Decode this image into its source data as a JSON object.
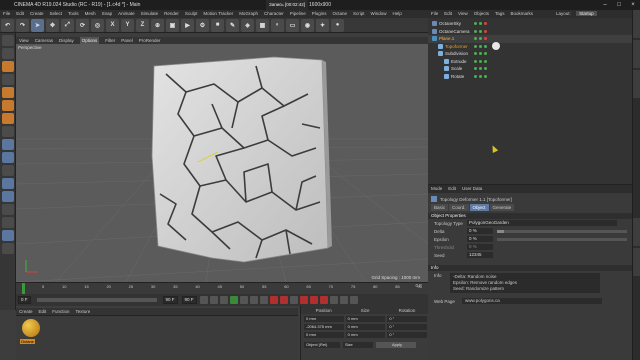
{
  "window": {
    "app_title": "CINEMA 4D R19.024 Studio (RC - R19) - [1.c4d *] - Main",
    "center_title": "1600x900",
    "overlay_title": "Запись [00:02:42]",
    "btn_min": "–",
    "btn_max": "□",
    "btn_close": "×"
  },
  "menubar": [
    "File",
    "Edit",
    "Create",
    "Select",
    "Tools",
    "Mesh",
    "Snap",
    "Animate",
    "Simulate",
    "Render",
    "Sculpt",
    "Motion Tracker",
    "MoGraph",
    "Character",
    "Pipeline",
    "Plugins",
    "Octane",
    "Script",
    "Window",
    "Help"
  ],
  "toolbar": {
    "x": "X",
    "y": "Y",
    "z": "Z"
  },
  "viewport": {
    "menu": [
      "View",
      "Cameras",
      "Display",
      "Options",
      "Filter",
      "Panel",
      "ProRender"
    ],
    "active_menu": "Options",
    "label": "Perspective",
    "grid_spacing": "Grid Spacing : 1000 mm"
  },
  "timeline": {
    "ticks": [
      "0",
      "5",
      "10",
      "15",
      "20",
      "25",
      "30",
      "35",
      "40",
      "45",
      "50",
      "55",
      "60",
      "65",
      "70",
      "75",
      "80",
      "85",
      "90"
    ],
    "current_frame": "0 F",
    "start_field": "0 F",
    "end_field": "90 F",
    "end_field2": "90 F"
  },
  "material": {
    "menu": [
      "Create",
      "Edit",
      "Function",
      "Texture"
    ],
    "mat_name": "Octane"
  },
  "coords": {
    "headers": [
      "Position",
      "Size",
      "Rotation"
    ],
    "px": "0 mm",
    "py": "-2064.375 mm",
    "pz": "0 mm",
    "sx": "0 mm",
    "sy": "0 mm",
    "sz": "0 mm",
    "rh": "0 °",
    "rp": "0 °",
    "rb": "0 °",
    "mode": "Object (Rel)",
    "size_mode": "Size",
    "apply": "Apply"
  },
  "objmgr": {
    "menu": [
      "File",
      "Edit",
      "View",
      "Objects",
      "Tags",
      "Bookmarks"
    ],
    "layout_label": "Layout:",
    "layout_value": "Startup",
    "objects": [
      {
        "name": "OctaneSky",
        "cls": "w",
        "indent": 0
      },
      {
        "name": "OctaneCamera",
        "cls": "w",
        "indent": 0
      },
      {
        "name": "Plane.1",
        "cls": "sel",
        "indent": 0
      },
      {
        "name": "Topoformer",
        "cls": "",
        "indent": 1
      },
      {
        "name": "Subdivision",
        "cls": "w",
        "indent": 1
      },
      {
        "name": "Extrude",
        "cls": "w",
        "indent": 2
      },
      {
        "name": "Scale",
        "cls": "w",
        "indent": 2
      },
      {
        "name": "Rotate",
        "cls": "w",
        "indent": 2
      }
    ]
  },
  "attr": {
    "menu": [
      "Mode",
      "Edit",
      "User Data"
    ],
    "object_title": "Topology Deformer 1.1 [Topoformer]",
    "tabs": [
      "Basic",
      "Coord.",
      "Object",
      "Generate"
    ],
    "active_tab": "Object",
    "section_object": "Object Properties",
    "params": [
      {
        "label": "Topology Type",
        "value": "PolygonGeoGarden"
      },
      {
        "label": "Delta",
        "value": "0 %"
      },
      {
        "label": "Epsilon",
        "value": "0 %"
      },
      {
        "label": "Threshold",
        "value": "0 %"
      },
      {
        "label": "Seed",
        "value": "12345"
      }
    ],
    "delta_fill": 0.05,
    "section_info": "Info",
    "info_label": "Info",
    "info_lines": [
      "-Delta: Random noise",
      "Epsilon: Remove random edges",
      "Seed: Randomize pattern"
    ],
    "webpage_label": "Web Page",
    "webpage_value": "www.polygons.ca"
  },
  "colors": {
    "accent": "#5d79a5",
    "highlight": "#e0a030",
    "cursor": "#d9c420"
  }
}
